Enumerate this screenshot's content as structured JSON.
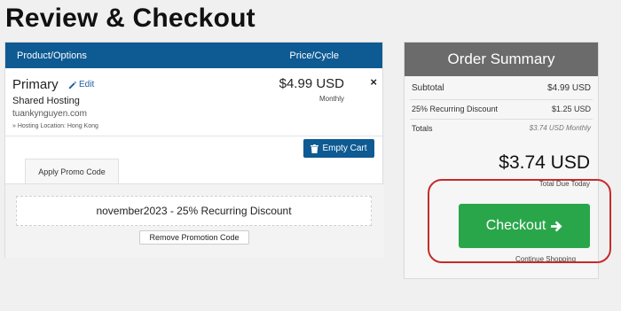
{
  "page": {
    "title": "Review & Checkout"
  },
  "cart": {
    "header": {
      "product": "Product/Options",
      "price": "Price/Cycle"
    },
    "item": {
      "name": "Primary",
      "edit_label": "Edit",
      "type": "Shared Hosting",
      "domain": "tuankynguyen.com",
      "location": "» Hosting Location: Hong Kong",
      "price": "$4.99 USD",
      "cycle": "Monthly",
      "remove": "×"
    },
    "empty_cart_label": "Empty Cart",
    "promo": {
      "tab_label": "Apply Promo Code",
      "applied": "november2023 - 25% Recurring Discount",
      "remove_label": "Remove Promotion Code"
    }
  },
  "summary": {
    "title": "Order Summary",
    "subtotal_label": "Subtotal",
    "subtotal_value": "$4.99 USD",
    "discount_label": "25% Recurring Discount",
    "discount_value": "$1.25 USD",
    "totals_label": "Totals",
    "totals_value": "$3.74 USD Monthly",
    "grand_total": "$3.74 USD",
    "total_due_label": "Total Due Today",
    "checkout_label": "Checkout",
    "continue_label": "Continue Shopping"
  },
  "colors": {
    "header_blue": "#0e5a93",
    "checkout_green": "#2aa64a",
    "summary_header": "#6b6b6b",
    "highlight_red": "#c62b2b"
  },
  "icons": {
    "edit": "pencil-icon",
    "empty_cart": "trash-icon",
    "checkout": "arrow-right-icon",
    "remove": "close-icon"
  }
}
